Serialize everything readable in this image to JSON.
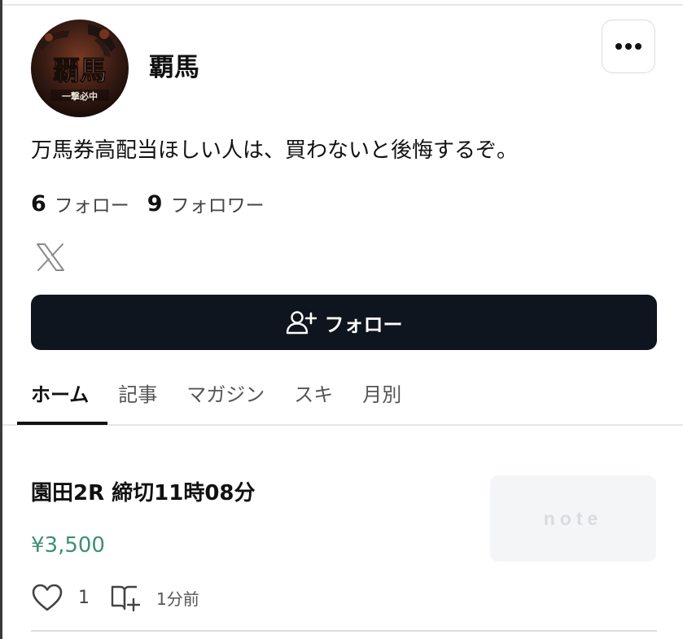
{
  "profile": {
    "name": "覇馬",
    "avatar_text": "覇馬",
    "avatar_subtext": "一撃必中",
    "bio": "万馬券高配当ほしい人は、買わないと後悔するぞ。"
  },
  "stats": {
    "following_count": "6",
    "following_label": "フォロー",
    "followers_count": "9",
    "followers_label": "フォロワー"
  },
  "social": {
    "icon": "x-logo-icon"
  },
  "follow_button": {
    "label": "フォロー",
    "icon": "add-user-icon"
  },
  "more_button": {
    "icon": "more-horizontal-icon"
  },
  "tabs": [
    {
      "label": "ホーム",
      "active": true
    },
    {
      "label": "記事",
      "active": false
    },
    {
      "label": "マガジン",
      "active": false
    },
    {
      "label": "スキ",
      "active": false
    },
    {
      "label": "月別",
      "active": false
    }
  ],
  "article": {
    "title": "園田2R 締切11時08分",
    "price": "¥3,500",
    "thumbnail_logo": "note",
    "like_count": "1",
    "time_ago": "1分前"
  },
  "colors": {
    "follow_button_bg": "#0f151e",
    "price_color": "#3f8f73",
    "active_tab": "#111111",
    "inactive_tab": "#555555"
  }
}
